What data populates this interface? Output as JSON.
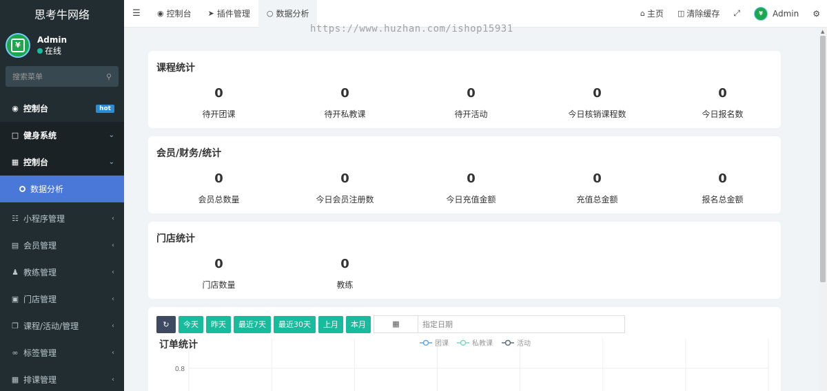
{
  "sidebar": {
    "brand": "思考牛网络",
    "user": {
      "name": "Admin",
      "status": "在线"
    },
    "search_placeholder": "搜索菜单",
    "items": [
      {
        "label": "控制台",
        "badge": "hot"
      },
      {
        "label": "健身系统"
      },
      {
        "label": "控制台"
      },
      {
        "label": "数据分析"
      },
      {
        "label": "小程序管理"
      },
      {
        "label": "会员管理"
      },
      {
        "label": "教练管理"
      },
      {
        "label": "门店管理"
      },
      {
        "label": "课程/活动/管理"
      },
      {
        "label": "标签管理"
      },
      {
        "label": "排课管理"
      }
    ]
  },
  "topnav": {
    "tabs": [
      "控制台",
      "插件管理",
      "数据分析"
    ],
    "right": {
      "home": "主页",
      "clear_cache": "清除缓存",
      "admin": "Admin"
    }
  },
  "watermark": "https://www.huzhan.com/ishop15931",
  "course_stats": {
    "title": "课程统计",
    "items": [
      {
        "value": "0",
        "label": "待开团课"
      },
      {
        "value": "0",
        "label": "待开私教课"
      },
      {
        "value": "0",
        "label": "待开活动"
      },
      {
        "value": "0",
        "label": "今日核销课程数"
      },
      {
        "value": "0",
        "label": "今日报名数"
      }
    ]
  },
  "member_stats": {
    "title": "会员/财务/统计",
    "items": [
      {
        "value": "0",
        "label": "会员总数量"
      },
      {
        "value": "0",
        "label": "今日会员注册数"
      },
      {
        "value": "0",
        "label": "今日充值金额"
      },
      {
        "value": "0",
        "label": "充值总金额"
      },
      {
        "value": "0",
        "label": "报名总金额"
      }
    ]
  },
  "store_stats": {
    "title": "门店统计",
    "items": [
      {
        "value": "0",
        "label": "门店数量"
      },
      {
        "value": "0",
        "label": "教练"
      }
    ]
  },
  "orders": {
    "buttons": [
      "今天",
      "昨天",
      "最近7天",
      "最近30天",
      "上月",
      "本月"
    ],
    "date_placeholder": "指定日期"
  },
  "chart_data": {
    "type": "line",
    "title": "订单统计",
    "series": [
      {
        "name": "团课",
        "values": [],
        "color": "#5aa9e6"
      },
      {
        "name": "私教课",
        "values": [],
        "color": "#7fd6c6"
      },
      {
        "name": "活动",
        "values": [],
        "color": "#5c6b7a"
      }
    ],
    "y_ticks_visible": [
      "0.8"
    ],
    "grid": true,
    "legend": "top-center"
  }
}
